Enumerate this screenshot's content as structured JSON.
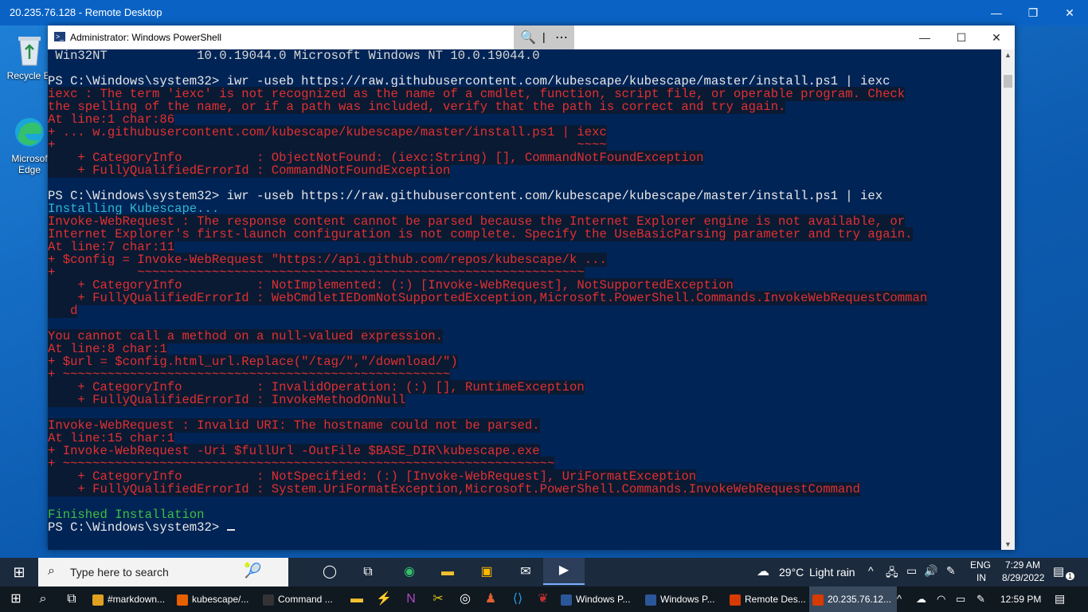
{
  "remote_desktop": {
    "title": "20.235.76.128 - Remote Desktop",
    "controls": {
      "minimize": "—",
      "restore": "❐",
      "close": "✕"
    }
  },
  "desktop_icons": [
    {
      "label": "Recycle Bi",
      "icon": "recycle-bin-icon"
    },
    {
      "label": "Microsof Edge",
      "icon": "edge-icon"
    }
  ],
  "powershell": {
    "title": "Administrator: Windows PowerShell",
    "toolbar": {
      "zoom": "🔍",
      "separator": "|",
      "more": "⋯"
    },
    "lines": [
      {
        "text": " Win32NT            10.0.19044.0 Microsoft Windows NT 10.0.19044.0",
        "style": "normal"
      },
      {
        "text": "",
        "style": "normal"
      },
      {
        "text": "PS C:\\Windows\\system32> iwr -useb https://raw.githubusercontent.com/kubescape/kubescape/master/install.ps1 | iexc",
        "style": "cmd"
      },
      {
        "text": "iexc : The term 'iexc' is not recognized as the name of a cmdlet, function, script file, or operable program. Check",
        "style": "err"
      },
      {
        "text": "the spelling of the name, or if a path was included, verify that the path is correct and try again.",
        "style": "err"
      },
      {
        "text": "At line:1 char:86",
        "style": "err"
      },
      {
        "text": "+ ... w.githubusercontent.com/kubescape/kubescape/master/install.ps1 | iexc",
        "style": "err"
      },
      {
        "text": "+                                                                      ~~~~",
        "style": "err"
      },
      {
        "text": "    + CategoryInfo          : ObjectNotFound: (iexc:String) [], CommandNotFoundException",
        "style": "err"
      },
      {
        "text": "    + FullyQualifiedErrorId : CommandNotFoundException",
        "style": "err"
      },
      {
        "text": "",
        "style": "normal"
      },
      {
        "text": "PS C:\\Windows\\system32> iwr -useb https://raw.githubusercontent.com/kubescape/kubescape/master/install.ps1 | iex",
        "style": "cmd"
      },
      {
        "text": "Installing Kubescape...",
        "style": "cyan"
      },
      {
        "text": "Invoke-WebRequest : The response content cannot be parsed because the Internet Explorer engine is not available, or",
        "style": "err"
      },
      {
        "text": "Internet Explorer's first-launch configuration is not complete. Specify the UseBasicParsing parameter and try again.",
        "style": "err"
      },
      {
        "text": "At line:7 char:11",
        "style": "err"
      },
      {
        "text": "+ $config = Invoke-WebRequest \"https://api.github.com/repos/kubescape/k ...",
        "style": "err"
      },
      {
        "text": "+           ~~~~~~~~~~~~~~~~~~~~~~~~~~~~~~~~~~~~~~~~~~~~~~~~~~~~~~~~~~~~",
        "style": "err"
      },
      {
        "text": "    + CategoryInfo          : NotImplemented: (:) [Invoke-WebRequest], NotSupportedException",
        "style": "err"
      },
      {
        "text": "    + FullyQualifiedErrorId : WebCmdletIEDomNotSupportedException,Microsoft.PowerShell.Commands.InvokeWebRequestComman",
        "style": "err"
      },
      {
        "text": "   d",
        "style": "err"
      },
      {
        "text": "",
        "style": "normal"
      },
      {
        "text": "You cannot call a method on a null-valued expression.",
        "style": "err"
      },
      {
        "text": "At line:8 char:1",
        "style": "err"
      },
      {
        "text": "+ $url = $config.html_url.Replace(\"/tag/\",\"/download/\")",
        "style": "err"
      },
      {
        "text": "+ ~~~~~~~~~~~~~~~~~~~~~~~~~~~~~~~~~~~~~~~~~~~~~~~~~~~~",
        "style": "err"
      },
      {
        "text": "    + CategoryInfo          : InvalidOperation: (:) [], RuntimeException",
        "style": "err"
      },
      {
        "text": "    + FullyQualifiedErrorId : InvokeMethodOnNull",
        "style": "err"
      },
      {
        "text": "",
        "style": "normal"
      },
      {
        "text": "Invoke-WebRequest : Invalid URI: The hostname could not be parsed.",
        "style": "err"
      },
      {
        "text": "At line:15 char:1",
        "style": "err"
      },
      {
        "text": "+ Invoke-WebRequest -Uri $fullUrl -OutFile $BASE_DIR\\kubescape.exe",
        "style": "err"
      },
      {
        "text": "+ ~~~~~~~~~~~~~~~~~~~~~~~~~~~~~~~~~~~~~~~~~~~~~~~~~~~~~~~~~~~~~~~~~~",
        "style": "err"
      },
      {
        "text": "    + CategoryInfo          : NotSpecified: (:) [Invoke-WebRequest], UriFormatException",
        "style": "err"
      },
      {
        "text": "    + FullyQualifiedErrorId : System.UriFormatException,Microsoft.PowerShell.Commands.InvokeWebRequestCommand",
        "style": "err"
      },
      {
        "text": "",
        "style": "normal"
      },
      {
        "text": "Finished Installation",
        "style": "green"
      },
      {
        "text": "PS C:\\Windows\\system32> ",
        "style": "cmd",
        "cursor": true
      }
    ]
  },
  "inner_taskbar": {
    "search_placeholder": "Type here to search",
    "weather": {
      "temp": "29°C",
      "desc": "Light rain"
    },
    "lang": {
      "line1": "ENG",
      "line2": "IN"
    },
    "clock": {
      "time": "7:29 AM",
      "date": "8/29/2022"
    },
    "notification_count": "1"
  },
  "host_taskbar": {
    "items": [
      {
        "label": "#markdown...",
        "icon": "markdown-app-icon",
        "color": "#e0a020"
      },
      {
        "label": "kubescape/...",
        "icon": "firefox-icon",
        "color": "#e66000"
      },
      {
        "label": "Command ...",
        "icon": "cmd-icon",
        "color": "#333333"
      },
      {
        "label": "Windows P...",
        "icon": "powershell-icon",
        "color": "#2b579a"
      },
      {
        "label": "Windows P...",
        "icon": "powershell-icon",
        "color": "#2b579a"
      },
      {
        "label": "Remote Des...",
        "icon": "remote-desktop-icon",
        "color": "#d83b01"
      },
      {
        "label": "20.235.76.12...",
        "icon": "remote-desktop-icon",
        "color": "#d83b01"
      }
    ],
    "clock": "12:59 PM"
  },
  "colors": {
    "console_bg": "#012456",
    "error": "#e23030",
    "title_bar": "#0a63c4"
  }
}
